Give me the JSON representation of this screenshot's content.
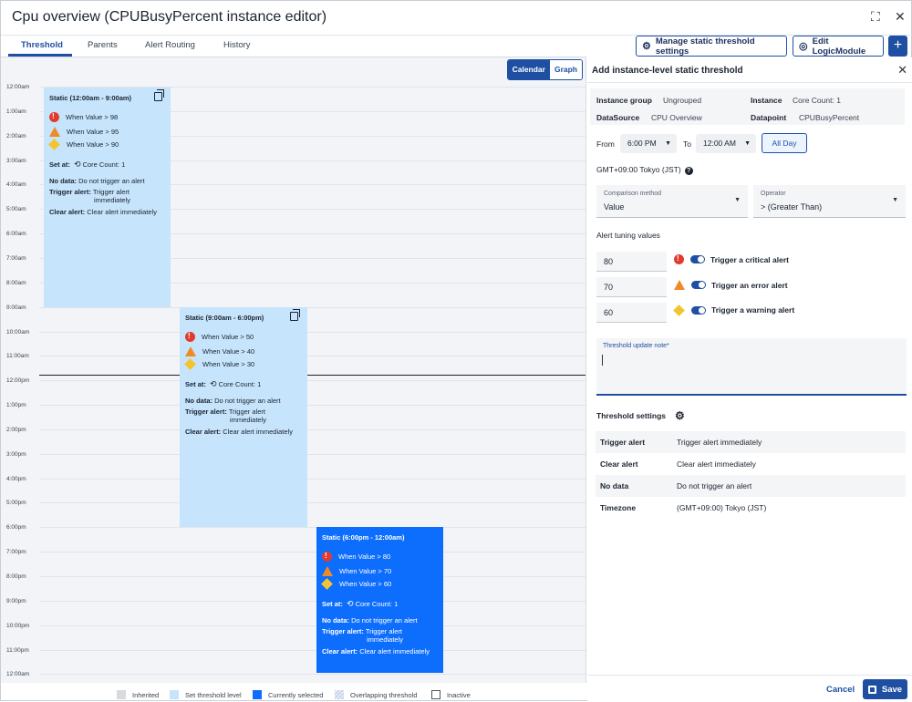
{
  "window": {
    "title": "Cpu overview (CPUBusyPercent instance editor)",
    "expand_glyph": "⛶",
    "close_glyph": "✕"
  },
  "tabs": [
    {
      "label": "Threshold"
    },
    {
      "label": "Parents"
    },
    {
      "label": "Alert Routing"
    },
    {
      "label": "History"
    }
  ],
  "toolbar": {
    "manage_label": "Manage static threshold settings",
    "edit_label": "Edit LogicModule",
    "plus_glyph": "+",
    "gear_glyph": "⚙",
    "globe_glyph": "◎"
  },
  "calendar": {
    "view_calendar": "Calendar",
    "view_graph": "Graph",
    "hours": [
      "12:00am",
      "1:00am",
      "2:00am",
      "3:00am",
      "4:00am",
      "5:00am",
      "6:00am",
      "7:00am",
      "8:00am",
      "9:00am",
      "10:00am",
      "11:00am",
      "12:00pm",
      "1:00pm",
      "2:00pm",
      "3:00pm",
      "4:00pm",
      "5:00pm",
      "6:00pm",
      "7:00pm",
      "8:00pm",
      "9:00pm",
      "10:00pm",
      "11:00pm",
      "12:00am"
    ],
    "blocks": [
      {
        "title": "Static (12:00am - 9:00am)",
        "critical": "When Value > 98",
        "error": "When Value > 95",
        "warning": "When Value > 90",
        "set_at_label": "Set at:",
        "set_at_value": "Core Count: 1",
        "no_data_label": "No data:",
        "no_data_value": "Do not trigger an alert",
        "trigger_label": "Trigger alert:",
        "trigger_value_1": "Trigger alert",
        "trigger_value_2": "immediately",
        "clear_label": "Clear alert:",
        "clear_value": "Clear alert immediately"
      },
      {
        "title": "Static (9:00am - 6:00pm)",
        "critical": "When Value > 50",
        "error": "When Value > 40",
        "warning": "When Value > 30",
        "set_at_label": "Set at:",
        "set_at_value": "Core Count: 1",
        "no_data_label": "No data:",
        "no_data_value": "Do not trigger an alert",
        "trigger_label": "Trigger alert:",
        "trigger_value_1": "Trigger alert",
        "trigger_value_2": "immediately",
        "clear_label": "Clear alert:",
        "clear_value": "Clear alert immediately"
      },
      {
        "title": "Static (6:00pm - 12:00am)",
        "critical": "When Value > 80",
        "error": "When Value > 70",
        "warning": "When Value > 60",
        "set_at_label": "Set at:",
        "set_at_value": "Core Count: 1",
        "no_data_label": "No data:",
        "no_data_value": "Do not trigger an alert",
        "trigger_label": "Trigger alert:",
        "trigger_value_1": "Trigger alert",
        "trigger_value_2": "immediately",
        "clear_label": "Clear alert:",
        "clear_value": "Clear alert immediately"
      }
    ],
    "legend": [
      {
        "label": "Inherited",
        "color": "#d9dadc"
      },
      {
        "label": "Set threshold level",
        "color": "#c6e4fb"
      },
      {
        "label": "Currently selected",
        "color": "#0d6efd"
      },
      {
        "label": "Overlapping threshold",
        "color": "#e6ecf7"
      },
      {
        "label": "Inactive",
        "color": "#ffffff"
      }
    ]
  },
  "panel": {
    "title": "Add instance-level static threshold",
    "close_glyph": "✕",
    "instance_group_label": "Instance group",
    "instance_group_value": "Ungrouped",
    "instance_label": "Instance",
    "instance_value": "Core Count: 1",
    "datasource_label": "DataSource",
    "datasource_value": "CPU Overview",
    "datapoint_label": "Datapoint",
    "datapoint_value": "CPUBusyPercent",
    "from_label": "From",
    "from_value": "6:00 PM",
    "to_label": "To",
    "to_value": "12:00 AM",
    "all_day_label": "All Day",
    "timezone": "GMT+09:00 Tokyo (JST)",
    "help_glyph": "?",
    "comparison_label": "Comparison method",
    "comparison_value": "Value",
    "operator_label": "Operator",
    "operator_value": "> (Greater Than)",
    "tuning_label": "Alert tuning values",
    "tuning": [
      {
        "value": "80",
        "label": "Trigger a critical alert"
      },
      {
        "value": "70",
        "label": "Trigger an error alert"
      },
      {
        "value": "60",
        "label": "Trigger a warning alert"
      }
    ],
    "note_label": "Threshold update note*",
    "settings_label": "Threshold settings",
    "settings": [
      {
        "key": "Trigger alert",
        "value": "Trigger alert immediately"
      },
      {
        "key": "Clear alert",
        "value": "Clear alert immediately"
      },
      {
        "key": "No data",
        "value": "Do not trigger an alert"
      },
      {
        "key": "Timezone",
        "value": "(GMT+09:00) Tokyo (JST)"
      }
    ],
    "cancel_label": "Cancel",
    "save_label": "Save"
  }
}
